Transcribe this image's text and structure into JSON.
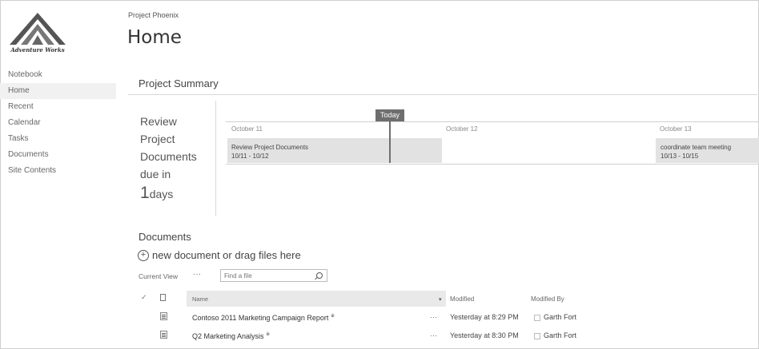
{
  "sidebar": {
    "logo_text": "Adventure Works",
    "items": [
      {
        "label": "Notebook",
        "selected": false
      },
      {
        "label": "Home",
        "selected": true
      },
      {
        "label": "Recent",
        "selected": false
      },
      {
        "label": "Calendar",
        "selected": false
      },
      {
        "label": "Tasks",
        "selected": false
      },
      {
        "label": "Documents",
        "selected": false
      },
      {
        "label": "Site Contents",
        "selected": false
      }
    ]
  },
  "header": {
    "site_title": "Project Phoenix",
    "page_title": "Home"
  },
  "summary": {
    "title": "Project Summary",
    "due_line1": "Review",
    "due_line2": "Project",
    "due_line3": "Documents",
    "due_line4": "due in",
    "due_days": "1",
    "due_unit": "days",
    "today_label": "Today",
    "dates": [
      "October 11",
      "October 12",
      "October 13"
    ],
    "tasks": [
      {
        "name": "Review Project Documents",
        "range": "10/11 - 10/12"
      },
      {
        "name": "coordinate team meeting",
        "range": "10/13 - 10/15"
      }
    ]
  },
  "documents": {
    "title": "Documents",
    "new_doc_label": "new document or drag files here",
    "current_view_label": "Current View",
    "ellipsis": "···",
    "search_placeholder": "Find a file",
    "columns": {
      "check": "✓",
      "name": "Name",
      "sort_arrow": "▾",
      "modified": "Modified",
      "modified_by": "Modified By"
    },
    "rows": [
      {
        "name": "Contoso 2011 Marketing Campaign Report",
        "new_mark": "※",
        "menu": "···",
        "modified": "Yesterday at 8:29 PM",
        "modified_by": "Garth Fort"
      },
      {
        "name": "Q2 Marketing Analysis",
        "new_mark": "※",
        "menu": "···",
        "modified": "Yesterday at 8:30 PM",
        "modified_by": "Garth Fort"
      }
    ]
  },
  "colors": {
    "today_marker": "#6e6e6e",
    "task_bar": "#e2e2e2",
    "selected_nav": "#f1f1f1"
  }
}
